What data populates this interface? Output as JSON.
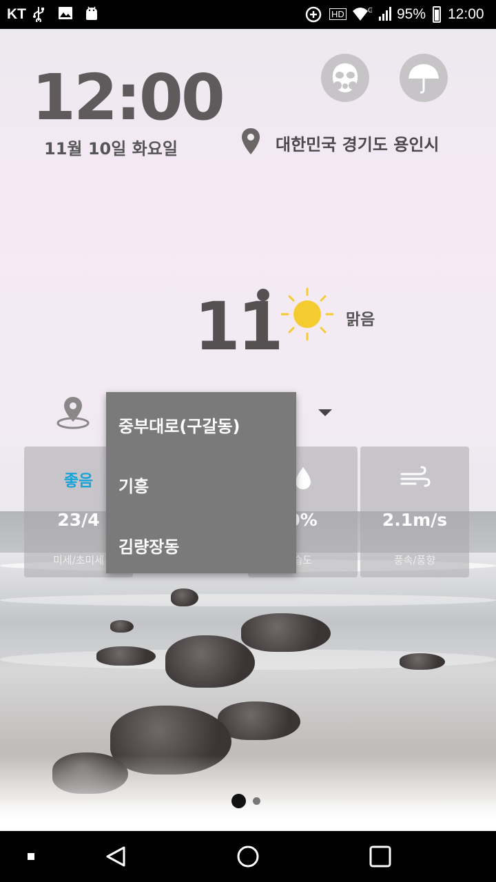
{
  "status_bar": {
    "carrier": "KT",
    "battery_percent": "95%",
    "time": "12:00",
    "hd_badge": "HD",
    "network_type": "G",
    "icons": [
      "usb-icon",
      "gallery-icon",
      "android-debug-icon",
      "data-saver-icon",
      "hd-voice-icon",
      "wifi-icon",
      "signal-icon",
      "battery-icon"
    ]
  },
  "clock": {
    "time": "12:00",
    "date": "11월 10일 화요일"
  },
  "location": {
    "text": "대한민국 경기도 용인시"
  },
  "weather": {
    "temperature": "11",
    "condition": "맑음",
    "icon": "sun-icon"
  },
  "dropdown": {
    "items": [
      "중부대로(구갈동)",
      "기흥",
      "김량장동"
    ]
  },
  "cards": {
    "air": {
      "status": "좋음",
      "value": "23/4",
      "label": "미세/초미세"
    },
    "humidity": {
      "value": "0%",
      "label": "습도",
      "icon": "drop-icon"
    },
    "wind": {
      "value": "2.1m/s",
      "label": "풍속/풍향",
      "icon": "wind-icon"
    }
  },
  "pager": {
    "pages": 2,
    "active": 1
  },
  "colors": {
    "accent": "#1aa3d6",
    "sun": "#f5cc2f",
    "dropdown_bg": "#7a7a7a"
  }
}
